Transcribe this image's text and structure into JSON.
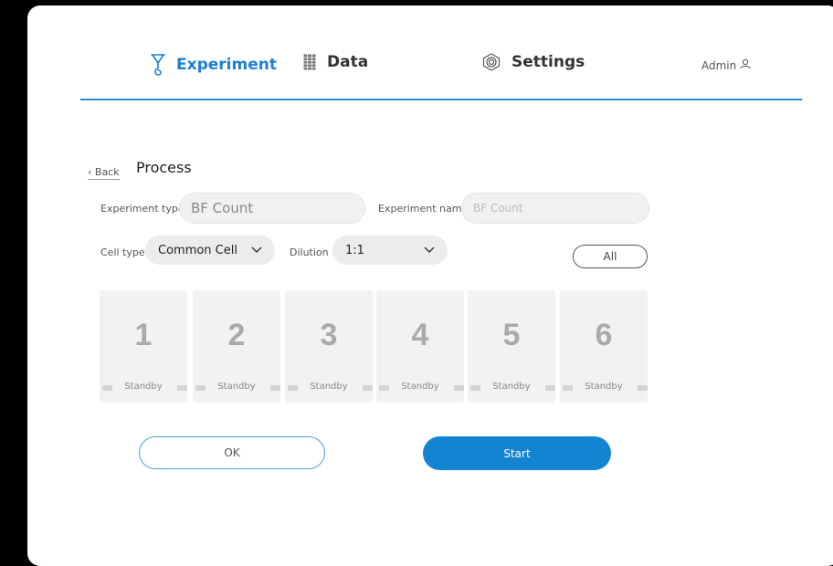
{
  "nav": {
    "experiment": {
      "label": "Experiment",
      "icon": "funnel-icon"
    },
    "data": {
      "label": "Data",
      "icon": "grid-icon"
    },
    "settings": {
      "label": "Settings",
      "icon": "gear-icon"
    },
    "user": {
      "label": "Admin",
      "icon": "user-icon"
    }
  },
  "page": {
    "back_label": "‹ Back",
    "title": "Process"
  },
  "form": {
    "experiment_type_label": "Experiment type",
    "experiment_type_value": "BF Count",
    "experiment_name_label": "Experiment name",
    "experiment_name_placeholder": "BF Count",
    "cell_type_label": "Cell type",
    "cell_type_value": "Common Cell",
    "dilution_label": "Dilution",
    "dilution_value": "1:1",
    "all_label": "All"
  },
  "channels": [
    {
      "number": "1",
      "status": "Standby"
    },
    {
      "number": "2",
      "status": "Standby"
    },
    {
      "number": "3",
      "status": "Standby"
    },
    {
      "number": "4",
      "status": "Standby"
    },
    {
      "number": "5",
      "status": "Standby"
    },
    {
      "number": "6",
      "status": "Standby"
    }
  ],
  "actions": {
    "ok_label": "OK",
    "start_label": "Start"
  },
  "colors": {
    "accent": "#1384d2",
    "nav_active": "#1f7fd0"
  }
}
